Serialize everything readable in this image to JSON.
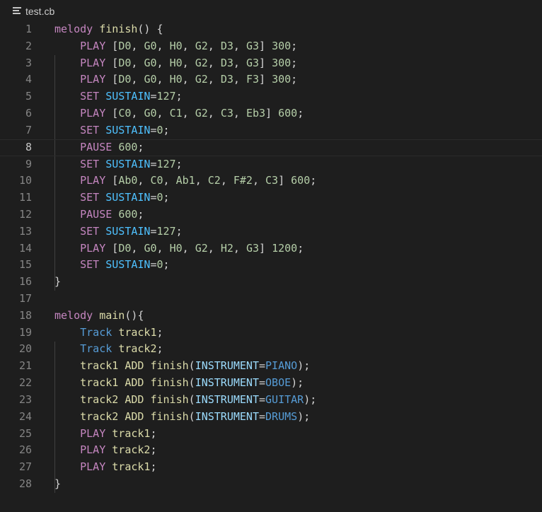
{
  "tab": {
    "filename": "test.cb",
    "icon": "list-lines-icon"
  },
  "colors": {
    "keyword": "#c586c0",
    "function": "#dcdcaa",
    "number": "#b5cea8",
    "constant": "#4fc1ff",
    "type": "#569cd6",
    "identifier": "#9cdcfe",
    "plain": "#d4d4d4"
  },
  "active_line": 8,
  "lines": [
    {
      "n": "1",
      "indent": "",
      "tokens": [
        [
          "kw",
          "melody"
        ],
        [
          "pl",
          " "
        ],
        [
          "fn",
          "finish"
        ],
        [
          "pl",
          "() {"
        ]
      ]
    },
    {
      "n": "2",
      "indent": "    ",
      "tokens": [
        [
          "kw",
          "PLAY"
        ],
        [
          "pl",
          " ["
        ],
        [
          "num",
          "D0"
        ],
        [
          "pl",
          ", "
        ],
        [
          "num",
          "G0"
        ],
        [
          "pl",
          ", "
        ],
        [
          "num",
          "H0"
        ],
        [
          "pl",
          ", "
        ],
        [
          "num",
          "G2"
        ],
        [
          "pl",
          ", "
        ],
        [
          "num",
          "D3"
        ],
        [
          "pl",
          ", "
        ],
        [
          "num",
          "G3"
        ],
        [
          "pl",
          "] "
        ],
        [
          "num",
          "300"
        ],
        [
          "pl",
          ";"
        ]
      ]
    },
    {
      "n": "3",
      "indent": "    ",
      "tokens": [
        [
          "kw",
          "PLAY"
        ],
        [
          "pl",
          " ["
        ],
        [
          "num",
          "D0"
        ],
        [
          "pl",
          ", "
        ],
        [
          "num",
          "G0"
        ],
        [
          "pl",
          ", "
        ],
        [
          "num",
          "H0"
        ],
        [
          "pl",
          ", "
        ],
        [
          "num",
          "G2"
        ],
        [
          "pl",
          ", "
        ],
        [
          "num",
          "D3"
        ],
        [
          "pl",
          ", "
        ],
        [
          "num",
          "G3"
        ],
        [
          "pl",
          "] "
        ],
        [
          "num",
          "300"
        ],
        [
          "pl",
          ";"
        ]
      ]
    },
    {
      "n": "4",
      "indent": "    ",
      "tokens": [
        [
          "kw",
          "PLAY"
        ],
        [
          "pl",
          " ["
        ],
        [
          "num",
          "D0"
        ],
        [
          "pl",
          ", "
        ],
        [
          "num",
          "G0"
        ],
        [
          "pl",
          ", "
        ],
        [
          "num",
          "H0"
        ],
        [
          "pl",
          ", "
        ],
        [
          "num",
          "G2"
        ],
        [
          "pl",
          ", "
        ],
        [
          "num",
          "D3"
        ],
        [
          "pl",
          ", "
        ],
        [
          "num",
          "F3"
        ],
        [
          "pl",
          "] "
        ],
        [
          "num",
          "300"
        ],
        [
          "pl",
          ";"
        ]
      ]
    },
    {
      "n": "5",
      "indent": "    ",
      "tokens": [
        [
          "kw",
          "SET"
        ],
        [
          "pl",
          " "
        ],
        [
          "con",
          "SUSTAIN"
        ],
        [
          "pl",
          "="
        ],
        [
          "num",
          "127"
        ],
        [
          "pl",
          ";"
        ]
      ]
    },
    {
      "n": "6",
      "indent": "    ",
      "tokens": [
        [
          "kw",
          "PLAY"
        ],
        [
          "pl",
          " ["
        ],
        [
          "num",
          "C0"
        ],
        [
          "pl",
          ", "
        ],
        [
          "num",
          "G0"
        ],
        [
          "pl",
          ", "
        ],
        [
          "num",
          "C1"
        ],
        [
          "pl",
          ", "
        ],
        [
          "num",
          "G2"
        ],
        [
          "pl",
          ", "
        ],
        [
          "num",
          "C3"
        ],
        [
          "pl",
          ", "
        ],
        [
          "num",
          "Eb3"
        ],
        [
          "pl",
          "] "
        ],
        [
          "num",
          "600"
        ],
        [
          "pl",
          ";"
        ]
      ]
    },
    {
      "n": "7",
      "indent": "    ",
      "tokens": [
        [
          "kw",
          "SET"
        ],
        [
          "pl",
          " "
        ],
        [
          "con",
          "SUSTAIN"
        ],
        [
          "pl",
          "="
        ],
        [
          "num",
          "0"
        ],
        [
          "pl",
          ";"
        ]
      ]
    },
    {
      "n": "8",
      "indent": "    ",
      "tokens": [
        [
          "kw",
          "PAUSE"
        ],
        [
          "pl",
          " "
        ],
        [
          "num",
          "600"
        ],
        [
          "pl",
          ";"
        ]
      ]
    },
    {
      "n": "9",
      "indent": "    ",
      "tokens": [
        [
          "kw",
          "SET"
        ],
        [
          "pl",
          " "
        ],
        [
          "con",
          "SUSTAIN"
        ],
        [
          "pl",
          "="
        ],
        [
          "num",
          "127"
        ],
        [
          "pl",
          ";"
        ]
      ]
    },
    {
      "n": "10",
      "indent": "    ",
      "tokens": [
        [
          "kw",
          "PLAY"
        ],
        [
          "pl",
          " ["
        ],
        [
          "num",
          "Ab0"
        ],
        [
          "pl",
          ", "
        ],
        [
          "num",
          "C0"
        ],
        [
          "pl",
          ", "
        ],
        [
          "num",
          "Ab1"
        ],
        [
          "pl",
          ", "
        ],
        [
          "num",
          "C2"
        ],
        [
          "pl",
          ", "
        ],
        [
          "num",
          "F#2"
        ],
        [
          "pl",
          ", "
        ],
        [
          "num",
          "C3"
        ],
        [
          "pl",
          "] "
        ],
        [
          "num",
          "600"
        ],
        [
          "pl",
          ";"
        ]
      ]
    },
    {
      "n": "11",
      "indent": "    ",
      "tokens": [
        [
          "kw",
          "SET"
        ],
        [
          "pl",
          " "
        ],
        [
          "con",
          "SUSTAIN"
        ],
        [
          "pl",
          "="
        ],
        [
          "num",
          "0"
        ],
        [
          "pl",
          ";"
        ]
      ]
    },
    {
      "n": "12",
      "indent": "    ",
      "tokens": [
        [
          "kw",
          "PAUSE"
        ],
        [
          "pl",
          " "
        ],
        [
          "num",
          "600"
        ],
        [
          "pl",
          ";"
        ]
      ]
    },
    {
      "n": "13",
      "indent": "    ",
      "tokens": [
        [
          "kw",
          "SET"
        ],
        [
          "pl",
          " "
        ],
        [
          "con",
          "SUSTAIN"
        ],
        [
          "pl",
          "="
        ],
        [
          "num",
          "127"
        ],
        [
          "pl",
          ";"
        ]
      ]
    },
    {
      "n": "14",
      "indent": "    ",
      "tokens": [
        [
          "kw",
          "PLAY"
        ],
        [
          "pl",
          " ["
        ],
        [
          "num",
          "D0"
        ],
        [
          "pl",
          ", "
        ],
        [
          "num",
          "G0"
        ],
        [
          "pl",
          ", "
        ],
        [
          "num",
          "H0"
        ],
        [
          "pl",
          ", "
        ],
        [
          "num",
          "G2"
        ],
        [
          "pl",
          ", "
        ],
        [
          "num",
          "H2"
        ],
        [
          "pl",
          ", "
        ],
        [
          "num",
          "G3"
        ],
        [
          "pl",
          "] "
        ],
        [
          "num",
          "1200"
        ],
        [
          "pl",
          ";"
        ]
      ]
    },
    {
      "n": "15",
      "indent": "    ",
      "tokens": [
        [
          "kw",
          "SET"
        ],
        [
          "pl",
          " "
        ],
        [
          "con",
          "SUSTAIN"
        ],
        [
          "pl",
          "="
        ],
        [
          "num",
          "0"
        ],
        [
          "pl",
          ";"
        ]
      ]
    },
    {
      "n": "16",
      "indent": "",
      "tokens": [
        [
          "pl",
          "}"
        ]
      ]
    },
    {
      "n": "17",
      "indent": "",
      "tokens": []
    },
    {
      "n": "18",
      "indent": "",
      "tokens": [
        [
          "kw",
          "melody"
        ],
        [
          "pl",
          " "
        ],
        [
          "fn",
          "main"
        ],
        [
          "pl",
          "(){"
        ]
      ]
    },
    {
      "n": "19",
      "indent": "    ",
      "tokens": [
        [
          "typ",
          "Track"
        ],
        [
          "pl",
          " "
        ],
        [
          "fn",
          "track1"
        ],
        [
          "pl",
          ";"
        ]
      ]
    },
    {
      "n": "20",
      "indent": "    ",
      "tokens": [
        [
          "typ",
          "Track"
        ],
        [
          "pl",
          " "
        ],
        [
          "fn",
          "track2"
        ],
        [
          "pl",
          ";"
        ]
      ]
    },
    {
      "n": "21",
      "indent": "    ",
      "tokens": [
        [
          "fn",
          "track1"
        ],
        [
          "pl",
          " "
        ],
        [
          "fn",
          "ADD"
        ],
        [
          "pl",
          " "
        ],
        [
          "fn",
          "finish"
        ],
        [
          "pl",
          "("
        ],
        [
          "id",
          "INSTRUMENT"
        ],
        [
          "pl",
          "="
        ],
        [
          "typ",
          "PIANO"
        ],
        [
          "pl",
          ");"
        ]
      ]
    },
    {
      "n": "22",
      "indent": "    ",
      "tokens": [
        [
          "fn",
          "track1"
        ],
        [
          "pl",
          " "
        ],
        [
          "fn",
          "ADD"
        ],
        [
          "pl",
          " "
        ],
        [
          "fn",
          "finish"
        ],
        [
          "pl",
          "("
        ],
        [
          "id",
          "INSTRUMENT"
        ],
        [
          "pl",
          "="
        ],
        [
          "typ",
          "OBOE"
        ],
        [
          "pl",
          ");"
        ]
      ]
    },
    {
      "n": "23",
      "indent": "    ",
      "tokens": [
        [
          "fn",
          "track2"
        ],
        [
          "pl",
          " "
        ],
        [
          "fn",
          "ADD"
        ],
        [
          "pl",
          " "
        ],
        [
          "fn",
          "finish"
        ],
        [
          "pl",
          "("
        ],
        [
          "id",
          "INSTRUMENT"
        ],
        [
          "pl",
          "="
        ],
        [
          "typ",
          "GUITAR"
        ],
        [
          "pl",
          ");"
        ]
      ]
    },
    {
      "n": "24",
      "indent": "    ",
      "tokens": [
        [
          "fn",
          "track2"
        ],
        [
          "pl",
          " "
        ],
        [
          "fn",
          "ADD"
        ],
        [
          "pl",
          " "
        ],
        [
          "fn",
          "finish"
        ],
        [
          "pl",
          "("
        ],
        [
          "id",
          "INSTRUMENT"
        ],
        [
          "pl",
          "="
        ],
        [
          "typ",
          "DRUMS"
        ],
        [
          "pl",
          ");"
        ]
      ]
    },
    {
      "n": "25",
      "indent": "    ",
      "tokens": [
        [
          "kw",
          "PLAY"
        ],
        [
          "pl",
          " "
        ],
        [
          "fn",
          "track1"
        ],
        [
          "pl",
          ";"
        ]
      ]
    },
    {
      "n": "26",
      "indent": "    ",
      "tokens": [
        [
          "kw",
          "PLAY"
        ],
        [
          "pl",
          " "
        ],
        [
          "fn",
          "track2"
        ],
        [
          "pl",
          ";"
        ]
      ]
    },
    {
      "n": "27",
      "indent": "    ",
      "tokens": [
        [
          "kw",
          "PLAY"
        ],
        [
          "pl",
          " "
        ],
        [
          "fn",
          "track1"
        ],
        [
          "pl",
          ";"
        ]
      ]
    },
    {
      "n": "28",
      "indent": "",
      "tokens": [
        [
          "pl",
          "}"
        ]
      ]
    }
  ]
}
